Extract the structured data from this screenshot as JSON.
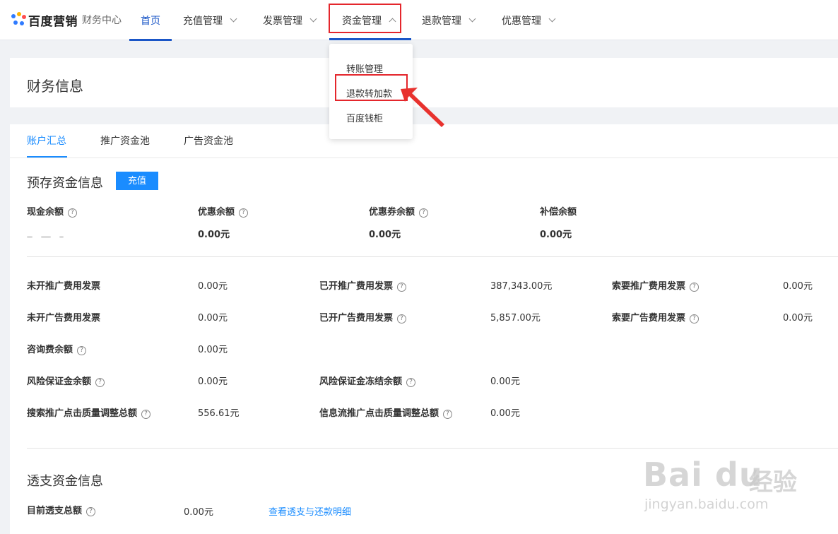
{
  "brand": {
    "name": "百度营销",
    "subtitle": "财务中心"
  },
  "nav": {
    "home": "首页",
    "recharge": "充值管理",
    "invoice": "发票管理",
    "funds": "资金管理",
    "refund": "退款管理",
    "discount": "优惠管理"
  },
  "dropdown": {
    "items": [
      "转账管理",
      "退款转加款",
      "百度钱柜"
    ]
  },
  "page_title": "财务信息",
  "tabs": [
    "账户汇总",
    "推广资金池",
    "广告资金池"
  ],
  "prepaid": {
    "title": "预存资金信息",
    "charge_button": "充值",
    "cash_label": "现金余额",
    "discount_label": "优惠余额",
    "discount_value": "0.00元",
    "coupon_label": "优惠券余额",
    "coupon_value": "0.00元",
    "comp_label": "补偿余额",
    "comp_value": "0.00元"
  },
  "details": {
    "r1": {
      "l1": "未开推广费用发票",
      "v1": "0.00元",
      "l2": "已开推广费用发票",
      "v2": "387,343.00元",
      "l3": "索要推广费用发票",
      "v3": "0.00元"
    },
    "r2": {
      "l1": "未开广告费用发票",
      "v1": "0.00元",
      "l2": "已开广告费用发票",
      "v2": "5,857.00元",
      "l3": "索要广告费用发票",
      "v3": "0.00元"
    },
    "r3": {
      "l1": "咨询费余额",
      "v1": "0.00元"
    },
    "r4": {
      "l1": "风险保证金余额",
      "v1": "0.00元",
      "l2": "风险保证金冻结余额",
      "v2": "0.00元"
    },
    "r5": {
      "l1": "搜索推广点击质量调整总额",
      "v1": "556.61元",
      "l2": "信息流推广点击质量调整总额",
      "v2": "0.00元"
    }
  },
  "overdraft": {
    "title": "透支资金信息",
    "total_label": "目前透支总额",
    "total_value": "0.00元",
    "detail_link": "查看透支与还款明细"
  },
  "watermark": {
    "logo": "Bai du",
    "cn": "经验",
    "url": "jingyan.baidu.com"
  },
  "colors": {
    "accent": "#1a8cff",
    "nav_active": "#1a56c7",
    "highlight": "#e4262c"
  },
  "icons": {
    "help": "help-circle-icon",
    "chevron": "chevron-icon",
    "arrow": "red-arrow-icon"
  }
}
